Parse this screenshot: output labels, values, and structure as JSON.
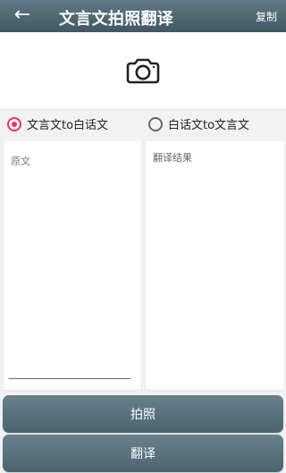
{
  "appbar": {
    "title": "文言文拍照翻译",
    "copy_label": "复制",
    "back_icon": "back-arrow"
  },
  "photo": {
    "icon": "camera-icon"
  },
  "modes": [
    {
      "label": "文言文to白话文",
      "selected": true
    },
    {
      "label": "白话文to文言文",
      "selected": false
    }
  ],
  "source": {
    "placeholder": "原文",
    "value": ""
  },
  "result": {
    "label": "翻译结果"
  },
  "buttons": {
    "photo": "拍照",
    "translate": "翻译"
  },
  "colors": {
    "appbar": "#4f6875",
    "selected_radio": "#e0356f",
    "button": "#56707c"
  }
}
